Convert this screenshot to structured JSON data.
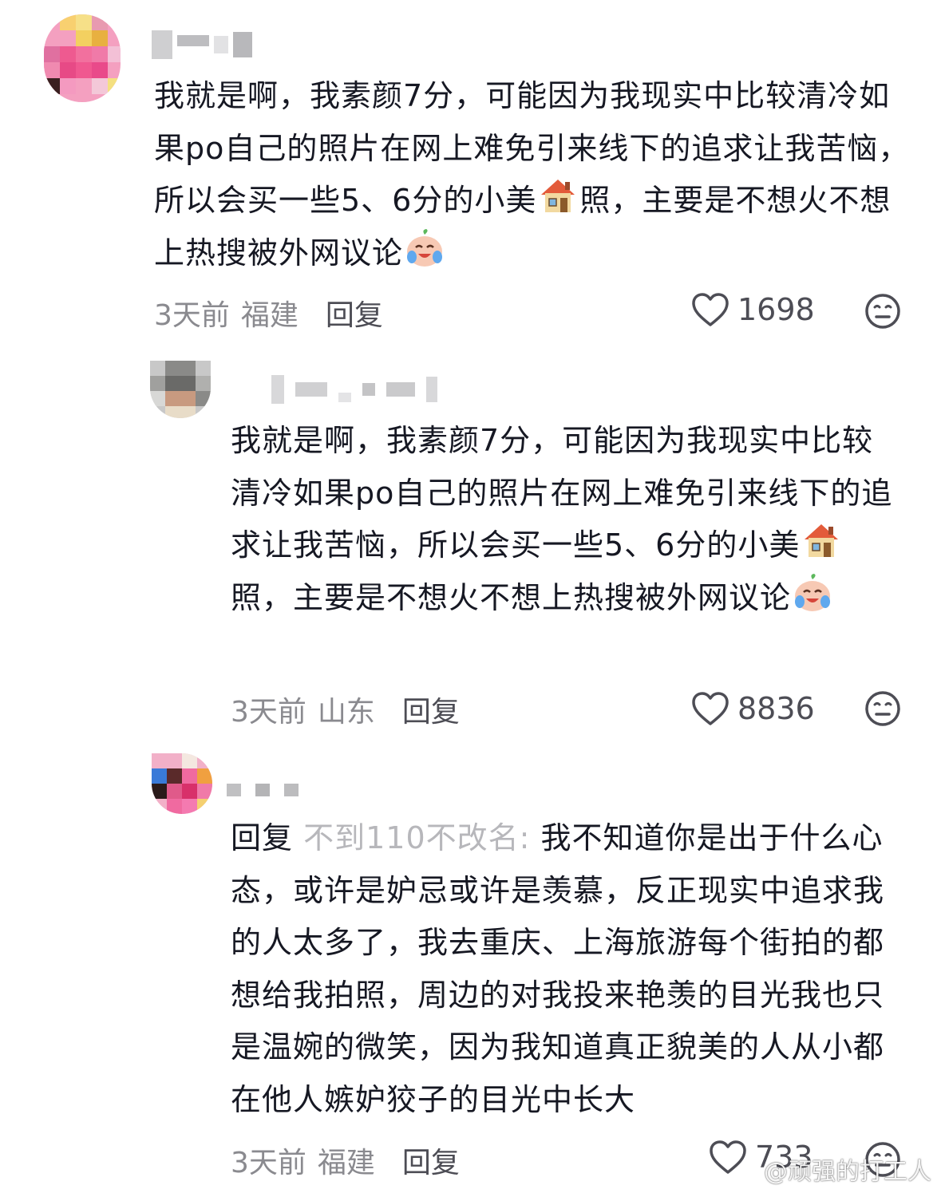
{
  "comments": [
    {
      "text": "我就是啊，我素颜7分，可能因为我现实中比较清冷如果po自己的照片在网上难免引来线下的追求让我苦恼，所以会买一些5、6分的小美",
      "text_after_house": "照，主要是不想火不想上热搜被外网议论",
      "time": "3天前",
      "location": "福建",
      "reply_label": "回复",
      "likes": "1698"
    },
    {
      "text": "我就是啊，我素颜7分，可能因为我现实中比较清冷如果po自己的照片在网上难免引来线下的追求让我苦恼，所以会买一些5、6分的小美",
      "text_after_house": "照，主要是不想火不想上热搜被外网议论",
      "time": "3天前",
      "location": "山东",
      "reply_label": "回复",
      "likes": "8836"
    },
    {
      "reply_prefix": "回复",
      "reply_target": "不到110不改名:",
      "text": "我不知道你是出于什么心态，或许是妒忌或许是羡慕，反正现实中追求我的人太多了，我去重庆、上海旅游每个街拍的都想给我拍照，周边的对我投来艳羡的目光我也只是温婉的微笑，因为我知道真正貌美的人从小都在他人嫉妒狡子的目光中长大",
      "time": "3天前",
      "location": "福建",
      "reply_label": "回复",
      "likes": "733"
    }
  ],
  "watermark": "@顽强的打工人",
  "colors": {
    "text": "#161823",
    "meta": "#8a8a8f",
    "reply_target": "#b7b7bb"
  }
}
